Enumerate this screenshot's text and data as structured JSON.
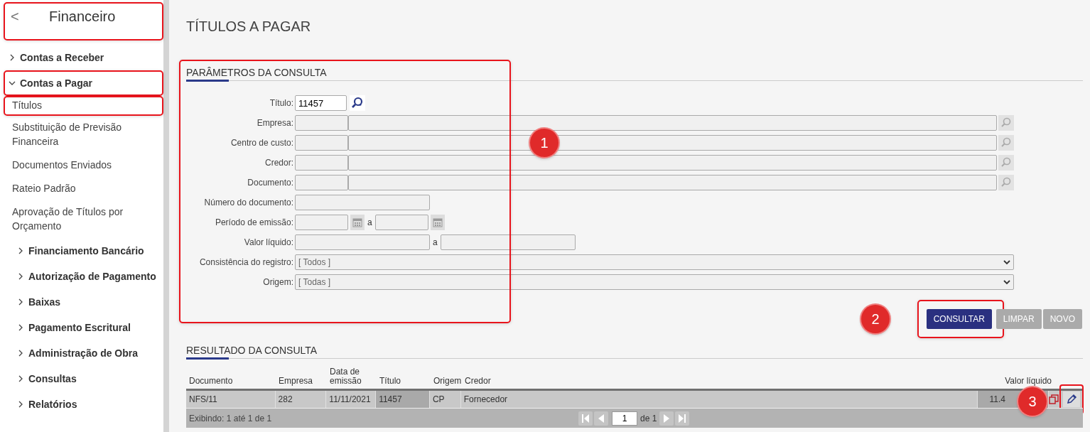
{
  "sidebar": {
    "title": "Financeiro",
    "back": "<",
    "highlighted": true,
    "items": [
      {
        "kind": "group",
        "label": "Contas a Receber",
        "expanded": false,
        "highlighted": false
      },
      {
        "kind": "group",
        "label": "Contas a Pagar",
        "expanded": true,
        "highlighted": true,
        "children": [
          {
            "kind": "item",
            "label": "Títulos",
            "highlighted": true
          },
          {
            "kind": "item",
            "label": "Substituição de Previsão Financeira",
            "highlighted": false
          },
          {
            "kind": "item",
            "label": "Documentos Enviados",
            "highlighted": false
          },
          {
            "kind": "item",
            "label": "Rateio Padrão",
            "highlighted": false
          },
          {
            "kind": "item",
            "label": "Aprovação de Títulos por Orçamento",
            "highlighted": false
          },
          {
            "kind": "group",
            "label": "Financiamento Bancário",
            "expanded": false,
            "highlighted": false
          },
          {
            "kind": "group",
            "label": "Autorização de Pagamento",
            "expanded": false,
            "highlighted": false
          },
          {
            "kind": "group",
            "label": "Baixas",
            "expanded": false,
            "highlighted": false
          },
          {
            "kind": "group",
            "label": "Pagamento Escritural",
            "expanded": false,
            "highlighted": false
          },
          {
            "kind": "group",
            "label": "Administração de Obra",
            "expanded": false,
            "highlighted": false
          },
          {
            "kind": "group",
            "label": "Consultas",
            "expanded": false,
            "highlighted": false
          },
          {
            "kind": "group",
            "label": "Relatórios",
            "expanded": false,
            "highlighted": false
          }
        ]
      }
    ]
  },
  "page_title": "TÍTULOS A PAGAR",
  "form": {
    "title": "PARÂMETROS DA CONSULTA",
    "highlighted": true,
    "badge": "1",
    "fields": [
      {
        "kind": "text",
        "label": "Título:",
        "value": "11457"
      },
      {
        "kind": "lookup",
        "label": "Empresa:"
      },
      {
        "kind": "lookup",
        "label": "Centro de custo:"
      },
      {
        "kind": "lookup",
        "label": "Credor:"
      },
      {
        "kind": "lookup",
        "label": "Documento:"
      },
      {
        "kind": "single",
        "label": "Número do documento:"
      },
      {
        "kind": "daterange",
        "label": "Período de emissão:",
        "separator": "a"
      },
      {
        "kind": "range",
        "label": "Valor líquido:",
        "separator": "a"
      },
      {
        "kind": "select",
        "label": "Consistência do registro:",
        "value": "[ Todos ]"
      },
      {
        "kind": "select",
        "label": "Origem:",
        "value": "[ Todas ]"
      }
    ]
  },
  "buttons": [
    {
      "label": "CONSULTAR",
      "primary": true,
      "highlighted": true
    },
    {
      "label": "LIMPAR",
      "primary": false,
      "highlighted": false
    },
    {
      "label": "NOVO",
      "primary": false,
      "highlighted": false
    }
  ],
  "buttons_badge": "2",
  "results": {
    "title": "RESULTADO DA CONSULTA",
    "columns": [
      "Documento",
      "Empresa",
      "Data de emissão",
      "Título",
      "Origem",
      "Credor",
      "Valor líquido"
    ],
    "rows": [
      {
        "cells": [
          "NFS/11",
          "282",
          "11/11/2021",
          "11457",
          "CP",
          "Fornecedor",
          "11.4"
        ],
        "edit_highlighted": true,
        "badge": "3"
      }
    ],
    "footer": "Exibindo: 1 até 1 de 1",
    "page": "1",
    "page_total": "de 1"
  }
}
